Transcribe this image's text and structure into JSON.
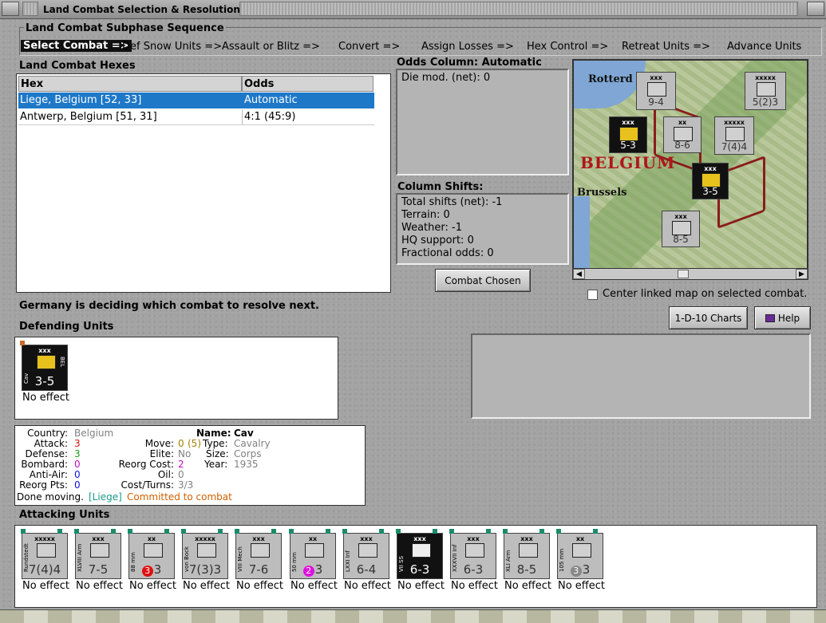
{
  "window": {
    "title": "Land Combat Selection & Resolution"
  },
  "subphase": {
    "label": "Land Combat Subphase Sequence",
    "steps": [
      "Select Combat =>",
      "Def Snow Units =>",
      "Assault or Blitz =>",
      "Convert =>",
      "Assign Losses =>",
      "Hex Control =>",
      "Retreat Units =>",
      "Advance Units"
    ],
    "active_index": 0
  },
  "hexes": {
    "label": "Land Combat Hexes",
    "columns": [
      "Hex",
      "Odds"
    ],
    "rows": [
      {
        "hex": "Liege, Belgium [52, 33]",
        "odds": "Automatic",
        "selected": true
      },
      {
        "hex": "Antwerp, Belgium [51, 31]",
        "odds": "4:1 (45:9)",
        "selected": false
      }
    ]
  },
  "odds": {
    "title": "Odds Column: Automatic",
    "die_mod": "Die mod. (net): 0"
  },
  "shifts": {
    "title": "Column Shifts:",
    "lines": [
      "Total shifts (net): -1",
      "Terrain: 0",
      "Weather: -1",
      "HQ support: 0",
      "Fractional odds: 0"
    ]
  },
  "buttons": {
    "combat_chosen": "Combat Chosen",
    "charts": "1-D-10 Charts",
    "help": "Help"
  },
  "map": {
    "country": "BELGIUM",
    "city_brussels": "Brussels",
    "city_rotterdam": "Rotterd",
    "counters": [
      {
        "strength": "9-4",
        "size": "xxx"
      },
      {
        "strength": "5-3",
        "size": "xxx"
      },
      {
        "strength": "8-6",
        "size": "xx"
      },
      {
        "strength": "7(4)4",
        "size": "xxxxx"
      },
      {
        "strength": "5(2)3",
        "size": "xxxxx"
      },
      {
        "strength": "8-5",
        "size": "xxx"
      },
      {
        "strength": "3-5",
        "size": "xxx"
      }
    ]
  },
  "center_map": {
    "label": "Center linked map on selected combat.",
    "checked": false
  },
  "status": "Germany is deciding which combat to resolve next.",
  "defending": {
    "label": "Defending Units",
    "units": [
      {
        "size": "xxx",
        "side": "Cav",
        "nation": "BEL",
        "strength": "3-5",
        "result": "No effect"
      }
    ]
  },
  "unit_info": {
    "country_label": "Country:",
    "country": "Belgium",
    "attack_label": "Attack:",
    "attack": "3",
    "defense_label": "Defense:",
    "defense": "3",
    "bombard_label": "Bombard:",
    "bombard": "0",
    "antiair_label": "Anti-Air:",
    "antiair": "0",
    "reorg_pts_label": "Reorg Pts:",
    "reorg_pts": "0",
    "name_label": "Name:",
    "name": "Cav",
    "move_label": "Move:",
    "move": "0",
    "move_extra": "(5)",
    "elite_label": "Elite:",
    "elite": "No",
    "reorg_cost_label": "Reorg Cost:",
    "reorg_cost": "2",
    "oil_label": "Oil:",
    "oil": "0",
    "cost_turns_label": "Cost/Turns:",
    "cost_turns": "3/3",
    "type_label": "Type:",
    "type": "Cavalry",
    "size_label": "Size:",
    "size": "Corps",
    "year_label": "Year:",
    "year": "1935",
    "done_moving": "Done moving.",
    "hex_ref": "[Liege]",
    "committed": "Committed to combat"
  },
  "attacking": {
    "label": "Attacking Units",
    "units": [
      {
        "size": "xxxxx",
        "side": "Rundstedt",
        "strength": "7(4)4",
        "result": "No effect",
        "dark": false
      },
      {
        "size": "xxx",
        "side": "XLVIII Arm",
        "strength": "7-5",
        "result": "No effect",
        "dark": false
      },
      {
        "size": "xx",
        "side": "88 mm",
        "strength": "3",
        "badge": "3",
        "result": "No effect",
        "dark": false
      },
      {
        "size": "xxxxx",
        "side": "von Bock",
        "strength": "7(3)3",
        "result": "No effect",
        "dark": false
      },
      {
        "size": "xxx",
        "side": "VIII Mech",
        "strength": "7-6",
        "result": "No effect",
        "dark": false
      },
      {
        "size": "xx",
        "side": "50 mm",
        "strength": "3",
        "badge": "2",
        "result": "No effect",
        "dark": false
      },
      {
        "size": "xxx",
        "side": "LXXI Inf",
        "strength": "6-4",
        "result": "No effect",
        "dark": false
      },
      {
        "size": "xxx",
        "side": "VII SS",
        "strength": "6-3",
        "result": "No effect",
        "dark": true
      },
      {
        "size": "xxx",
        "side": "XXXVII Inf",
        "strength": "6-3",
        "result": "No effect",
        "dark": false
      },
      {
        "size": "xxx",
        "side": "XLI Arm",
        "strength": "8-5",
        "result": "No effect",
        "dark": false
      },
      {
        "size": "xx",
        "side": "105 mm",
        "strength": "3",
        "badge": "3",
        "result": "No effect",
        "dark": false
      }
    ]
  },
  "colors": {
    "selected_row": "#1e78c8",
    "attack": "#d01010",
    "defense": "#1a9a1a",
    "bombard": "#c010c0",
    "antiair": "#1010d0",
    "gray_value": "#808080",
    "move_extra": "#a08000",
    "hex_ref": "#1a9a8a",
    "committed": "#d06000"
  }
}
